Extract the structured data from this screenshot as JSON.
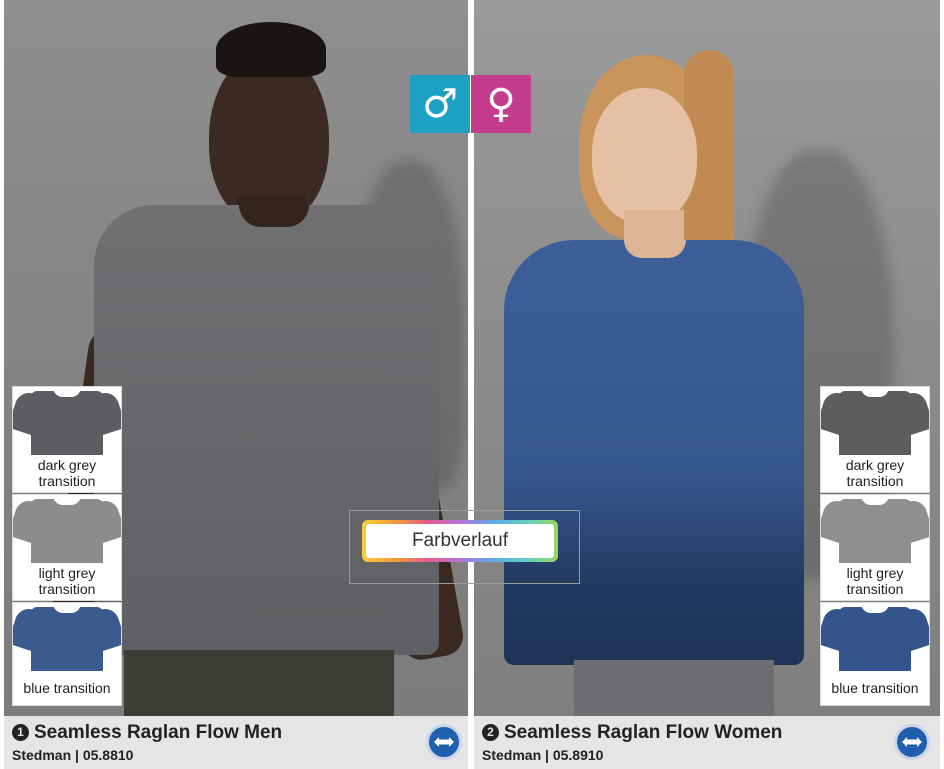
{
  "gender_badges": {
    "male_symbol": "♂",
    "female_symbol": "♀",
    "male_color": "#1ca0c4",
    "female_color": "#c43d8c"
  },
  "left_swatches": [
    {
      "label": "dark grey transition",
      "color": "#5c5d60"
    },
    {
      "label": "light grey transition",
      "color": "#8c8c8d"
    },
    {
      "label": "blue transition",
      "color": "#3a5b8d"
    }
  ],
  "right_swatches": [
    {
      "label": "dark grey transition",
      "color": "#5d5d60"
    },
    {
      "label": "light grey transition",
      "color": "#8f8f90"
    },
    {
      "label": "blue transition",
      "color": "#33558c"
    }
  ],
  "center_badge": {
    "label": "Farbverlauf"
  },
  "products": [
    {
      "number": "❶",
      "title": "Seamless Raglan Flow Men",
      "brand_code": "Stedman | 05.8810",
      "swap_icon": "swap-arrows-icon"
    },
    {
      "number": "❷",
      "title": "Seamless Raglan Flow Women",
      "brand_code": "Stedman | 05.8910",
      "swap_icon": "swap-arrows-icon"
    }
  ]
}
